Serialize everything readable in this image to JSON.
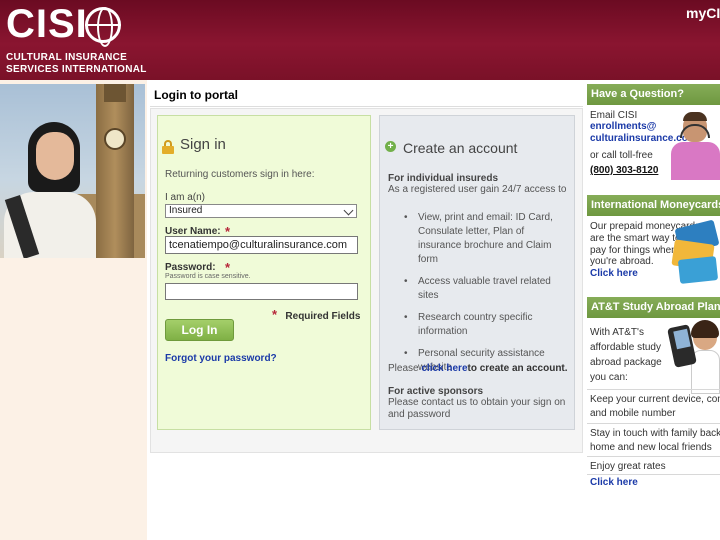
{
  "header": {
    "logo_text": "CISI",
    "logo_sub_line1": "CULTURAL INSURANCE",
    "logo_sub_line2": "SERVICES INTERNATIONAL",
    "mycisi": "myCI"
  },
  "main": {
    "page_title": "Login to portal"
  },
  "signin": {
    "title": "Sign in",
    "returning_text": "Returning customers sign in here:",
    "iam_label": "I am a(n)",
    "iam_selected": "Insured",
    "username_label": "User Name:",
    "username_value": "tcenatiempo@culturalinsurance.com",
    "password_label": "Password:",
    "case_note": "Password is case sensitive.",
    "required_star": "*",
    "required_fields": "Required Fields",
    "login_label": "Log In",
    "forgot_link": "Forgot your password?"
  },
  "create": {
    "icon": "plus-icon",
    "title": "Create an account",
    "individual_title": "For individual insureds",
    "individual_desc": "As a registered user gain 24/7 access to",
    "bullets": [
      "View, print and email: ID Card, Consulate letter, Plan of insurance brochure and Claim form",
      "Access valuable travel related sites",
      "Research country specific information",
      "Personal security assistance website"
    ],
    "please_prefix": "Please ",
    "click_here": "click here",
    "please_suffix": "to create an account.",
    "sponsor_title": "For active sponsors",
    "sponsor_desc": "Please contact us to obtain your sign on and password"
  },
  "sidebar": {
    "question": {
      "title": "Have a Question?",
      "email_label": "Email CISI",
      "email_line1": "enrollments@",
      "email_line2": "culturalinsurance.com",
      "toll_free": "or call toll-free",
      "phone": "(800) 303-8120"
    },
    "moneycards": {
      "title": "International Moneycards",
      "line1": "Our prepaid moneycards",
      "line2": "are the smart way to",
      "line3": "pay for things when",
      "line4": "you're abroad.",
      "link": "Click here"
    },
    "att": {
      "title": "AT&T Study Abroad Plans",
      "line1": "With AT&T's",
      "line2": "affordable study",
      "line3": "abroad package",
      "line4": "you can:",
      "item1_line1": "Keep your current device, conte",
      "item1_line2": "and mobile number",
      "item2_line1": "Stay in touch with family back",
      "item2_line2": "home and new local friends",
      "item3": "Enjoy great rates",
      "link": "Click here"
    }
  },
  "colors": {
    "header": "#7a1128",
    "sidebar_header": "#78a24a",
    "signin_panel": "#f0fbd8",
    "create_panel": "#e7eaee",
    "link": "#1b3aa8",
    "required": "#b6273a"
  }
}
